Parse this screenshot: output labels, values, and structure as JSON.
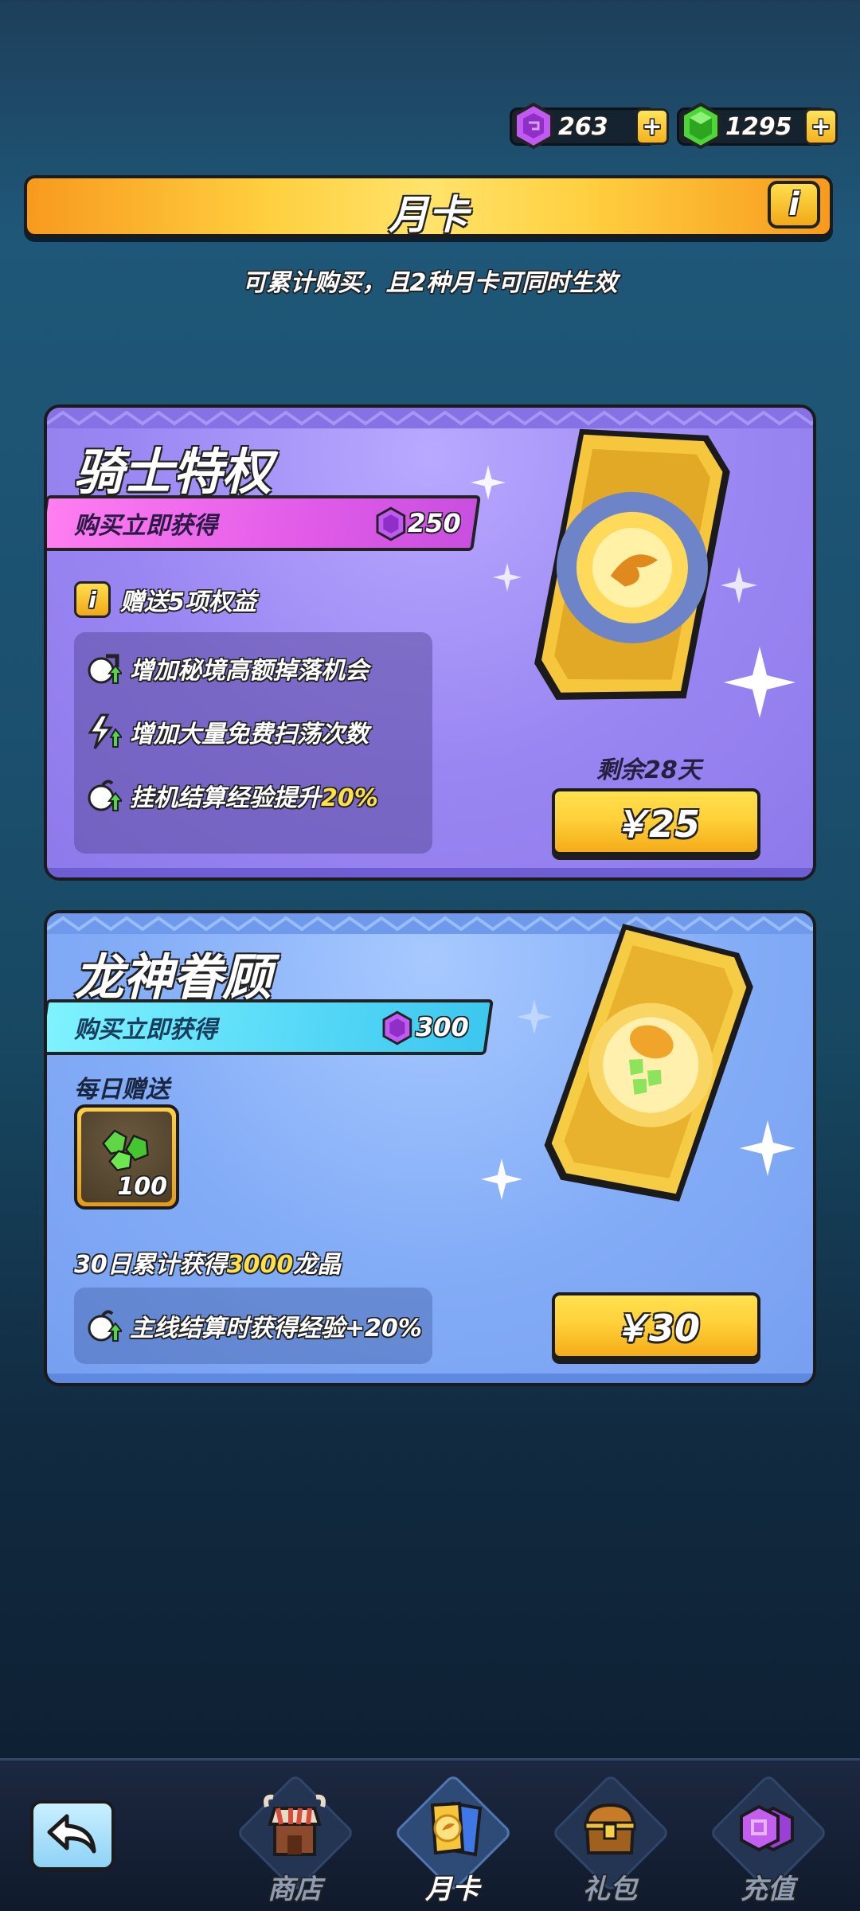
{
  "currency": {
    "purple_amount": "263",
    "green_amount": "1295",
    "plus_label": "+",
    "purple_color": "#b34be8",
    "green_color": "#3ec42a"
  },
  "header": {
    "title": "月卡",
    "info_label": "i",
    "subtitle": "可累计购买，且2种月卡可同时生效"
  },
  "knight": {
    "name": "骑士特权",
    "instant_label": "购买立即获得",
    "instant_amount": "250",
    "benefit_info_label": "i",
    "benefit_head": "赠送5项权益",
    "benefits": [
      {
        "text": "增加秘境高额掉落机会"
      },
      {
        "text": "增加大量免费扫荡次数"
      },
      {
        "text_prefix": "挂机结算经验提升",
        "highlight": "20%"
      }
    ],
    "remain": "剩余28天",
    "price": "￥25"
  },
  "dragon": {
    "name": "龙神眷顾",
    "instant_label": "购买立即获得",
    "instant_amount": "300",
    "daily_label": "每日赠送",
    "daily_item_qty": "100",
    "accum_prefix": "30日累计获得",
    "accum_highlight": "3000",
    "accum_suffix": "龙晶",
    "exp_text": "主线结算时获得经验+20%",
    "price": "￥30"
  },
  "nav": {
    "tabs": [
      {
        "label": "商店",
        "icon": "shop-icon"
      },
      {
        "label": "月卡",
        "icon": "month-card-icon",
        "active": true
      },
      {
        "label": "礼包",
        "icon": "chest-icon"
      },
      {
        "label": "充值",
        "icon": "recharge-gem-icon"
      }
    ]
  }
}
